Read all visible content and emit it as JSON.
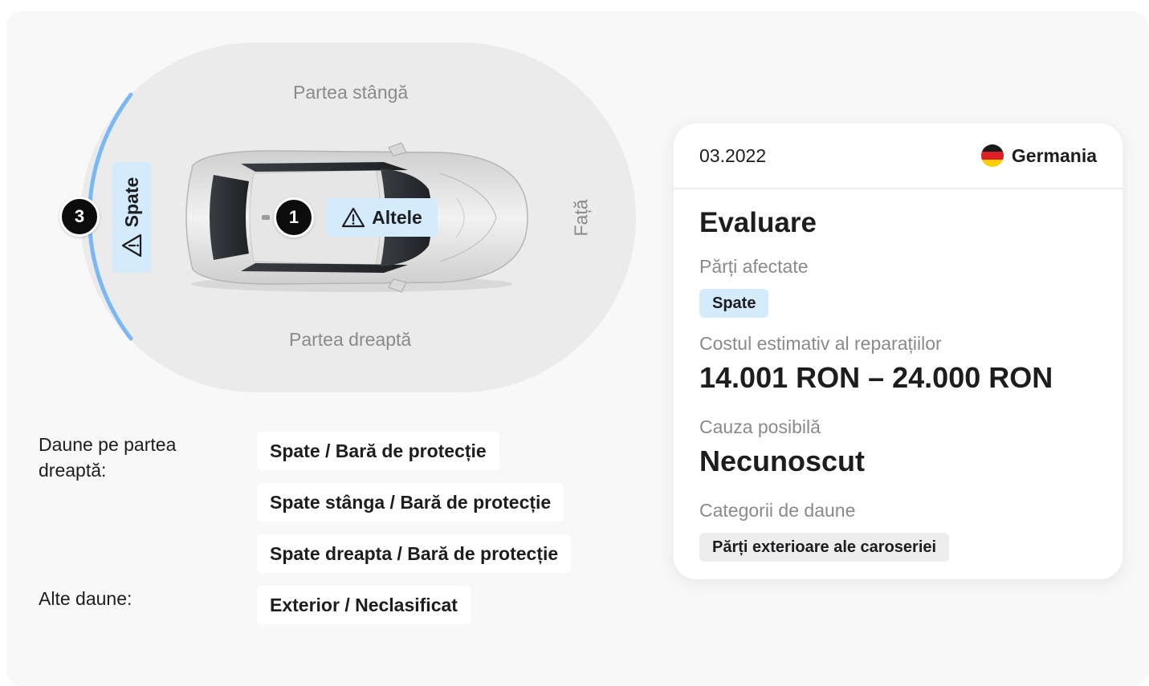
{
  "diagram": {
    "side_left_label": "Partea stângă",
    "side_right_label": "Partea dreaptă",
    "front_label": "Față",
    "marker_center": {
      "number": "1",
      "label": "Altele"
    },
    "marker_rear": {
      "number": "3",
      "label": "Spate"
    },
    "accent_color": "#7ab8f5"
  },
  "damages": {
    "right_side_label": "Daune pe partea dreaptă:",
    "right_side_items": [
      "Spate / Bară de protecție",
      "Spate stânga / Bară de protecție",
      "Spate dreapta / Bară de protecție"
    ],
    "other_label": "Alte daune:",
    "other_items": [
      "Exterior / Neclasificat"
    ]
  },
  "evaluation": {
    "date": "03.2022",
    "country": "Germania",
    "country_flag": "germany-flag",
    "title": "Evaluare",
    "affected_parts_label": "Părți afectate",
    "affected_parts": [
      "Spate"
    ],
    "cost_label": "Costul estimativ al reparațiilor",
    "cost_value": "14.001 RON – 24.000 RON",
    "cause_label": "Cauza posibilă",
    "cause_value": "Necunoscut",
    "categories_label": "Categorii de daune",
    "categories": [
      "Părți exterioare ale caroseriei"
    ]
  }
}
